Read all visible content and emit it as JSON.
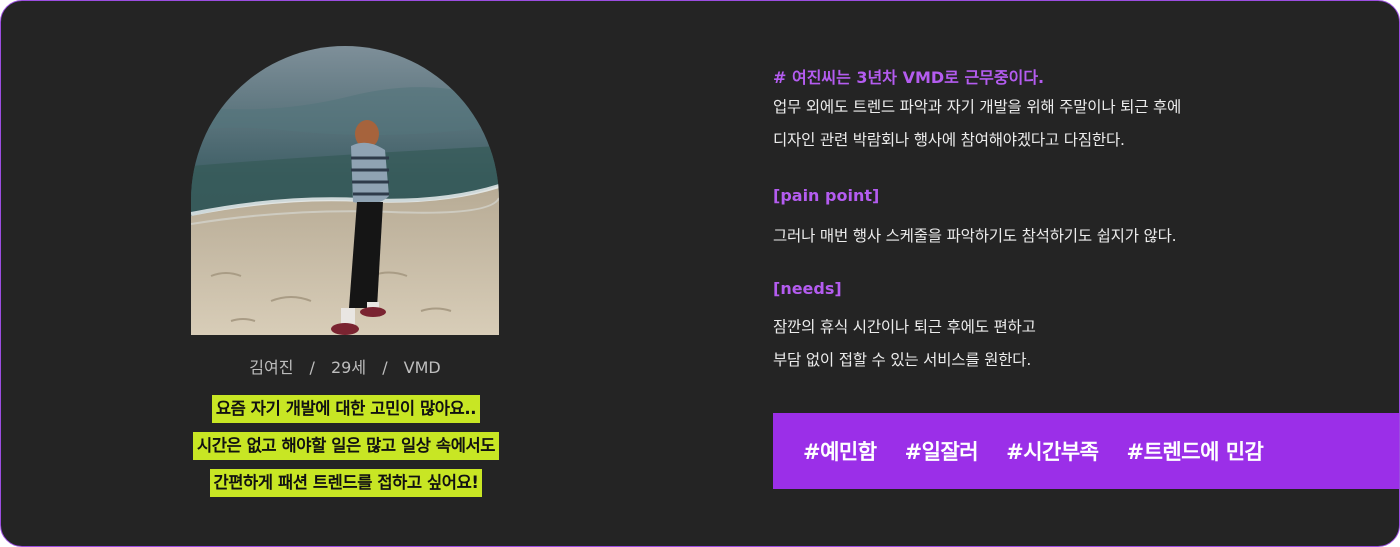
{
  "profile": {
    "name": "김여진",
    "age": "29세",
    "role": "VMD",
    "separator": "/",
    "quote_lines": [
      "요즘 자기 개발에 대한 고민이 많아요..",
      "시간은 없고 해야할 일은 많고 일상 속에서도",
      "간편하게 패션 트렌드를 접하고 싶어요!"
    ]
  },
  "description": {
    "intro_heading": "# 여진씨는 3년차 VMD로 근무중이다.",
    "intro_lines": [
      "업무 외에도 트렌드 파악과 자기 개발을 위해 주말이나 퇴근 후에",
      "디자인 관련 박람회나 행사에 참여해야겠다고 다짐한다."
    ],
    "pain_heading": "[pain point]",
    "pain_lines": [
      "그러나 매번 행사 스케줄을 파악하기도 참석하기도 쉽지가 않다."
    ],
    "needs_heading": "[needs]",
    "needs_lines": [
      "잠깐의 휴식 시간이나 퇴근 후에도 편하고",
      "부담 없이 접할 수 있는 서비스를 원한다."
    ]
  },
  "tags": [
    "#예민함",
    "#일잘러",
    "#시간부족",
    "#트렌드에 민감"
  ],
  "colors": {
    "background": "#242424",
    "border": "#9b4de0",
    "accent_purple": "#b45cf0",
    "tag_bar": "#9b2fe8",
    "highlight": "#c8e624"
  }
}
